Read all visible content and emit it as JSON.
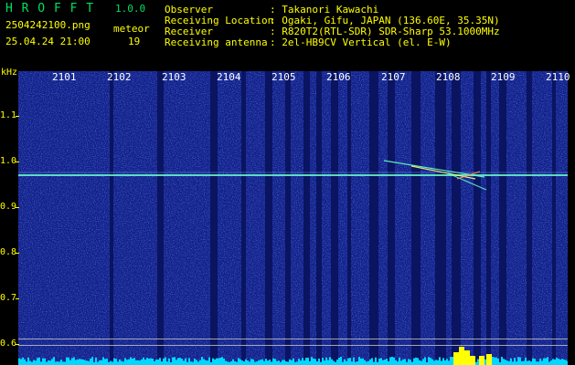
{
  "header": {
    "app_title": "H R O F F T",
    "version": "1.0.0",
    "filename": "2504242100.png",
    "datetime": "25.04.24 21:00",
    "meteor_label": "meteor",
    "meteor_count": "19",
    "info": [
      {
        "label": "Observer",
        "value": ": Takanori Kawachi"
      },
      {
        "label": "Receiving Location",
        "value": ": Ogaki, Gifu, JAPAN (136.60E, 35.35N)"
      },
      {
        "label": "Receiver",
        "value": ": R820T2(RTL-SDR) SDR-Sharp 53.1000MHz"
      },
      {
        "label": "Receiving antenna",
        "value": ": 2el-HB9CV Vertical (el. E-W)"
      }
    ]
  },
  "axis": {
    "unit": "kHz",
    "y_ticks": [
      "1.1",
      "1.0",
      "0.9",
      "0.8",
      "0.7",
      "0.6"
    ],
    "x_ticks": [
      "2101",
      "2102",
      "2103",
      "2104",
      "2105",
      "2106",
      "2107",
      "2108",
      "2109",
      "2110"
    ]
  },
  "colors": {
    "background": "#12208a",
    "text_header": "#ffff00",
    "title_green": "#00e060",
    "signal": "#66ffcc",
    "meteor_burst": "#ffff00",
    "bottom_trace": "#00d8ff"
  }
}
